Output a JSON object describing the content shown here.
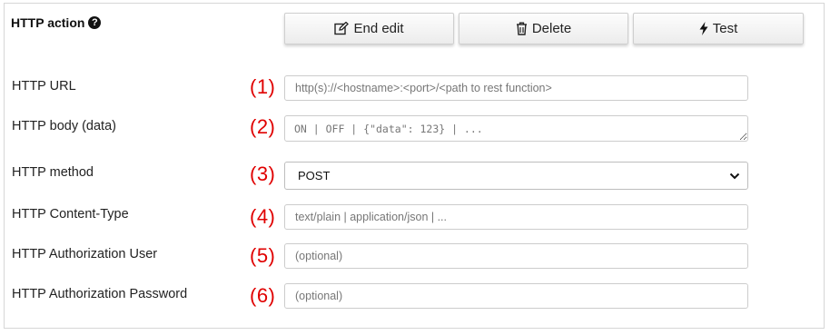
{
  "section": {
    "title": "HTTP action",
    "help_icon": "question-circle-icon"
  },
  "buttons": {
    "end_edit": {
      "label": "End edit",
      "icon": "edit-icon"
    },
    "delete": {
      "label": "Delete",
      "icon": "trash-icon"
    },
    "test": {
      "label": "Test",
      "icon": "bolt-icon"
    }
  },
  "fields": {
    "url": {
      "label": "HTTP URL",
      "marker": "(1)",
      "value": "",
      "placeholder": "http(s)://<hostname>:<port>/<path to rest function>"
    },
    "body": {
      "label": "HTTP body (data)",
      "marker": "(2)",
      "value": "",
      "placeholder": "ON | OFF | {\"data\": 123} | ..."
    },
    "method": {
      "label": "HTTP method",
      "marker": "(3)",
      "value": "POST",
      "icon": "chevron-down-icon"
    },
    "content_type": {
      "label": "HTTP Content-Type",
      "marker": "(4)",
      "value": "",
      "placeholder": "text/plain | application/json | ..."
    },
    "auth_user": {
      "label": "HTTP Authorization User",
      "marker": "(5)",
      "value": "",
      "placeholder": "(optional)"
    },
    "auth_password": {
      "label": "HTTP Authorization Password",
      "marker": "(6)",
      "value": "",
      "placeholder": "(optional)"
    }
  },
  "colors": {
    "marker": "#e00000",
    "border": "#cccccc",
    "button_bg": "#f2f2f2"
  }
}
